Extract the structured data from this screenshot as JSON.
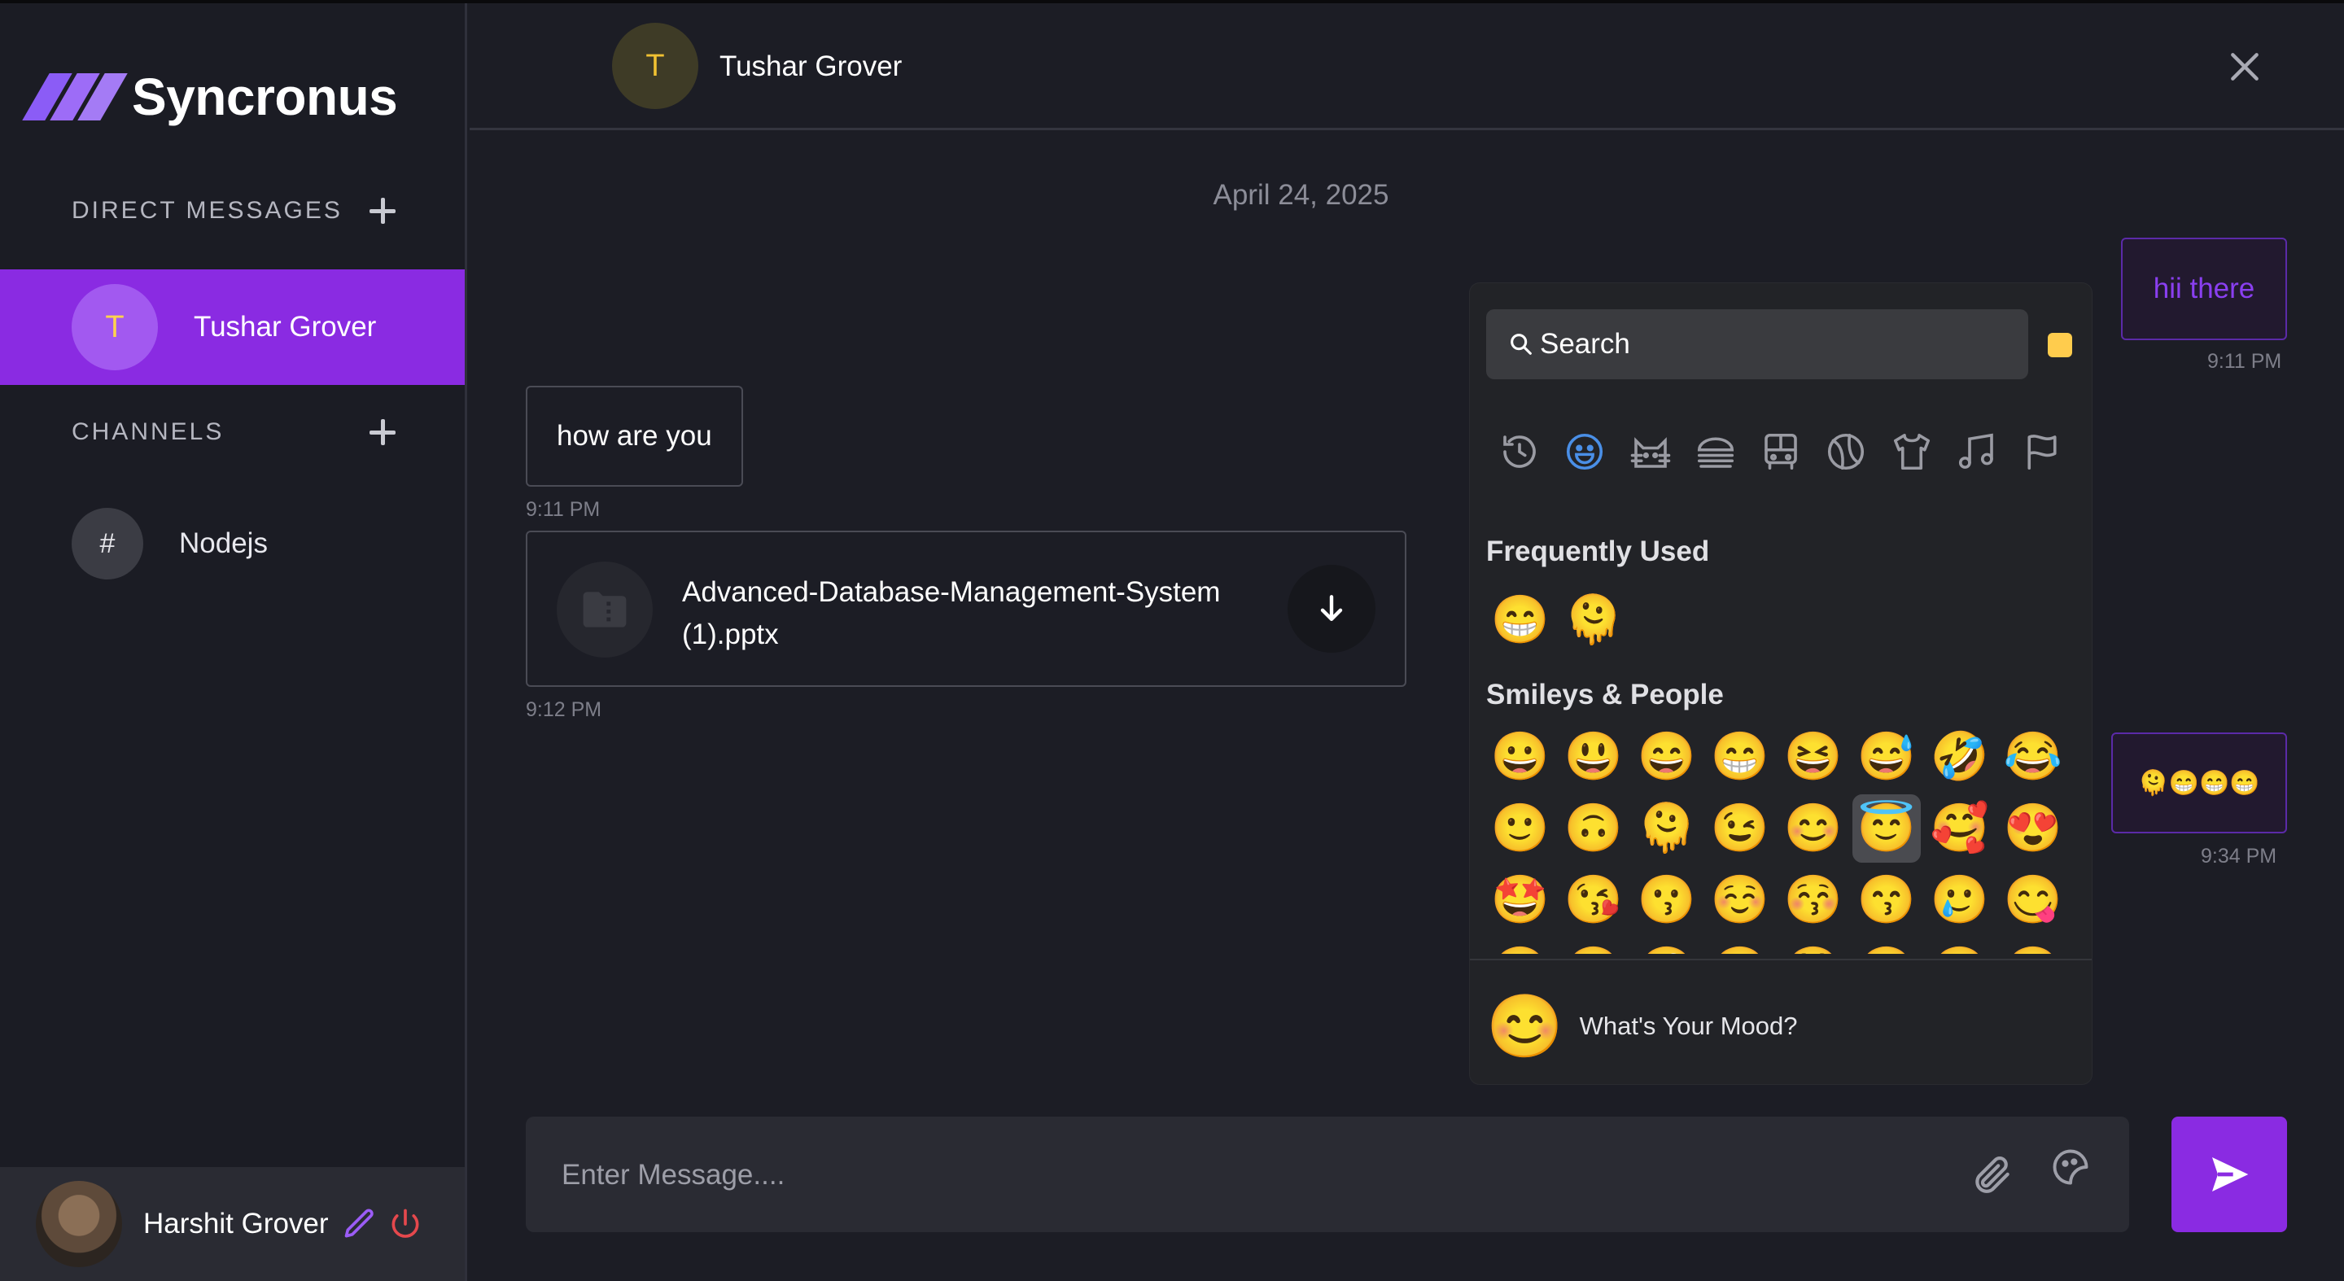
{
  "app": {
    "name": "Syncronus"
  },
  "sidebar": {
    "dm_title": "DIRECT MESSAGES",
    "channels_title": "CHANNELS",
    "dms": [
      {
        "initial": "T",
        "name": "Tushar Grover",
        "active": true
      }
    ],
    "channels": [
      {
        "symbol": "#",
        "name": "Nodejs"
      }
    ],
    "profile": {
      "name": "Harshit Grover"
    }
  },
  "header": {
    "initial": "T",
    "name": "Tushar Grover"
  },
  "chat": {
    "date": "April 24, 2025",
    "messages": [
      {
        "side": "out",
        "text": "hii there",
        "time": "9:11 PM"
      },
      {
        "side": "in",
        "text": "how are you",
        "time": "9:11 PM"
      },
      {
        "side": "in",
        "type": "file",
        "filename": "Advanced-Database-Management-System (1).pptx",
        "time": "9:12 PM"
      },
      {
        "side": "out",
        "text": "🫠😁😁😁",
        "time": "9:34 PM"
      }
    ]
  },
  "emoji_picker": {
    "search_placeholder": "Search",
    "categories": [
      "recent-icon",
      "smileys-icon",
      "animals-icon",
      "food-icon",
      "travel-icon",
      "activity-icon",
      "objects-icon",
      "symbols-icon",
      "flags-icon"
    ],
    "frequently_used_label": "Frequently Used",
    "frequently_used": [
      "😁",
      "🫠"
    ],
    "smileys_label": "Smileys & People",
    "smileys": [
      "😀",
      "😃",
      "😄",
      "😁",
      "😆",
      "😅",
      "🤣",
      "😂",
      "🙂",
      "🙃",
      "🫠",
      "😉",
      "😊",
      "😇",
      "🥰",
      "😍",
      "🤩",
      "😘",
      "😗",
      "☺️",
      "😚",
      "😙",
      "🥲",
      "😋",
      "😛",
      "😜",
      "🤪",
      "😝",
      "🤑",
      "🤗",
      "🤭",
      "🫢"
    ],
    "selected_emoji": "😇",
    "mood_emoji": "😊",
    "mood_text": "What's Your Mood?",
    "accent": "#ffcc4d"
  },
  "composer": {
    "placeholder": "Enter Message...."
  },
  "colors": {
    "accent": "#8a2be2",
    "background": "#1c1d25",
    "picker": "#222327"
  }
}
